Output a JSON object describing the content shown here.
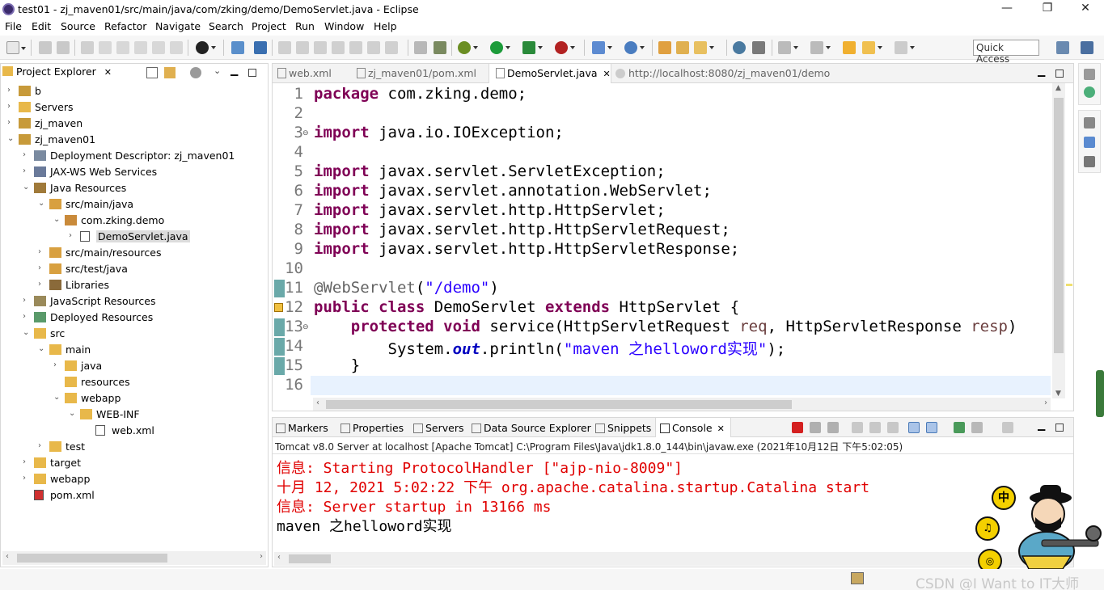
{
  "window": {
    "title": "test01 - zj_maven01/src/main/java/com/zking/demo/DemoServlet.java - Eclipse",
    "minimize": "—",
    "maximize": "❐",
    "close": "✕"
  },
  "menu": [
    "File",
    "Edit",
    "Source",
    "Refactor",
    "Navigate",
    "Search",
    "Project",
    "Run",
    "Window",
    "Help"
  ],
  "toolbar": {
    "quick_access_label": "Quick Access"
  },
  "project_explorer": {
    "title": "Project Explorer",
    "close": "✕",
    "tree": [
      {
        "label": "b",
        "depth": 0,
        "expand": "›",
        "icon": "project-icon"
      },
      {
        "label": "Servers",
        "depth": 0,
        "expand": "›",
        "icon": "folder-icon"
      },
      {
        "label": "zj_maven",
        "depth": 0,
        "expand": "›",
        "icon": "project-icon"
      },
      {
        "label": "zj_maven01",
        "depth": 0,
        "expand": "⌄",
        "icon": "project-icon"
      },
      {
        "label": "Deployment Descriptor: zj_maven01",
        "depth": 1,
        "expand": "›",
        "icon": "descriptor-icon"
      },
      {
        "label": "JAX-WS Web Services",
        "depth": 1,
        "expand": "›",
        "icon": "webservices-icon"
      },
      {
        "label": "Java Resources",
        "depth": 1,
        "expand": "⌄",
        "icon": "java-resources-icon"
      },
      {
        "label": "src/main/java",
        "depth": 2,
        "expand": "⌄",
        "icon": "source-folder-icon"
      },
      {
        "label": "com.zking.demo",
        "depth": 3,
        "expand": "⌄",
        "icon": "package-icon"
      },
      {
        "label": "DemoServlet.java",
        "depth": 4,
        "expand": "›",
        "icon": "java-file-icon",
        "selected": true
      },
      {
        "label": "src/main/resources",
        "depth": 2,
        "expand": "›",
        "icon": "source-folder-icon"
      },
      {
        "label": "src/test/java",
        "depth": 2,
        "expand": "›",
        "icon": "source-folder-icon"
      },
      {
        "label": "Libraries",
        "depth": 2,
        "expand": "›",
        "icon": "libraries-icon"
      },
      {
        "label": "JavaScript Resources",
        "depth": 1,
        "expand": "›",
        "icon": "js-resources-icon"
      },
      {
        "label": "Deployed Resources",
        "depth": 1,
        "expand": "›",
        "icon": "deployed-resources-icon"
      },
      {
        "label": "src",
        "depth": 1,
        "expand": "⌄",
        "icon": "folder-icon"
      },
      {
        "label": "main",
        "depth": 2,
        "expand": "⌄",
        "icon": "folder-icon"
      },
      {
        "label": "java",
        "depth": 3,
        "expand": "›",
        "icon": "folder-icon"
      },
      {
        "label": "resources",
        "depth": 3,
        "expand": "",
        "icon": "folder-icon"
      },
      {
        "label": "webapp",
        "depth": 3,
        "expand": "⌄",
        "icon": "folder-icon"
      },
      {
        "label": "WEB-INF",
        "depth": 4,
        "expand": "⌄",
        "icon": "folder-icon"
      },
      {
        "label": "web.xml",
        "depth": 5,
        "expand": "",
        "icon": "xml-file-icon"
      },
      {
        "label": "test",
        "depth": 2,
        "expand": "›",
        "icon": "folder-icon"
      },
      {
        "label": "target",
        "depth": 1,
        "expand": "›",
        "icon": "folder-icon"
      },
      {
        "label": "webapp",
        "depth": 1,
        "expand": "›",
        "icon": "folder-icon"
      },
      {
        "label": "pom.xml",
        "depth": 1,
        "expand": "",
        "icon": "maven-pom-icon"
      }
    ]
  },
  "editor": {
    "tabs": [
      {
        "label": "web.xml",
        "active": false
      },
      {
        "label": "zj_maven01/pom.xml",
        "active": false
      },
      {
        "label": "DemoServlet.java",
        "active": true,
        "close": "✕"
      },
      {
        "label": "http://localhost:8080/zj_maven01/demo",
        "active": false
      }
    ],
    "line_numbers": [
      "1",
      "2",
      "3",
      "4",
      "5",
      "6",
      "7",
      "8",
      "9",
      "10",
      "11",
      "12",
      "13",
      "14",
      "15",
      "16"
    ],
    "lines": [
      [
        {
          "t": "package",
          "c": "kw"
        },
        {
          "t": " com.zking.demo;"
        }
      ],
      [],
      [
        {
          "t": "import",
          "c": "kw"
        },
        {
          "t": " java.io.IOException;"
        }
      ],
      [],
      [
        {
          "t": "import",
          "c": "kw"
        },
        {
          "t": " javax.servlet.ServletException;"
        }
      ],
      [
        {
          "t": "import",
          "c": "kw"
        },
        {
          "t": " javax.servlet.annotation.WebServlet;"
        }
      ],
      [
        {
          "t": "import",
          "c": "kw"
        },
        {
          "t": " javax.servlet.http.HttpServlet;"
        }
      ],
      [
        {
          "t": "import",
          "c": "kw"
        },
        {
          "t": " javax.servlet.http.HttpServletRequest;"
        }
      ],
      [
        {
          "t": "import",
          "c": "kw"
        },
        {
          "t": " javax.servlet.http.HttpServletResponse;"
        }
      ],
      [],
      [
        {
          "t": "@WebServlet",
          "c": "ann"
        },
        {
          "t": "("
        },
        {
          "t": "\"/demo\"",
          "c": "str"
        },
        {
          "t": ")"
        }
      ],
      [
        {
          "t": "public",
          "c": "kw"
        },
        {
          "t": " "
        },
        {
          "t": "class",
          "c": "kw"
        },
        {
          "t": " DemoServlet "
        },
        {
          "t": "extends",
          "c": "kw"
        },
        {
          "t": " HttpServlet {"
        }
      ],
      [
        {
          "t": "    "
        },
        {
          "t": "protected",
          "c": "kw"
        },
        {
          "t": " "
        },
        {
          "t": "void",
          "c": "kw"
        },
        {
          "t": " service(HttpServletRequest "
        },
        {
          "t": "req",
          "c": "var"
        },
        {
          "t": ", HttpServletResponse "
        },
        {
          "t": "resp",
          "c": "var"
        },
        {
          "t": ")"
        }
      ],
      [
        {
          "t": "        System."
        },
        {
          "t": "out",
          "c": "fld"
        },
        {
          "t": ".println("
        },
        {
          "t": "\"maven 之helloword实现\"",
          "c": "str"
        },
        {
          "t": ");"
        }
      ],
      [
        {
          "t": "    }"
        }
      ],
      []
    ]
  },
  "console_panel": {
    "tabs": [
      "Markers",
      "Properties",
      "Servers",
      "Data Source Explorer",
      "Snippets",
      "Console"
    ],
    "active_tab": "Console",
    "close": "✕",
    "process_label": "Tomcat v8.0 Server at localhost [Apache Tomcat] C:\\Program Files\\Java\\jdk1.8.0_144\\bin\\javaw.exe (2021年10月12日 下午5:02:05)",
    "lines": [
      {
        "text": "信息: Starting ProtocolHandler [\"ajp-nio-8009\"]",
        "err": true
      },
      {
        "text": "十月 12, 2021 5:02:22 下午 org.apache.catalina.startup.Catalina start",
        "err": true
      },
      {
        "text": "信息: Server startup in 13166 ms",
        "err": true
      },
      {
        "text": "maven 之helloword实现",
        "err": false
      }
    ]
  },
  "overlay": {
    "badge_zhong": "中",
    "watermark": "CSDN @I Want to IT大师"
  },
  "colors": {
    "keyword": "#7f0055",
    "string": "#2a00ff",
    "annotation": "#646464",
    "console_error": "#e00000",
    "selection": "#dcdcdc"
  }
}
